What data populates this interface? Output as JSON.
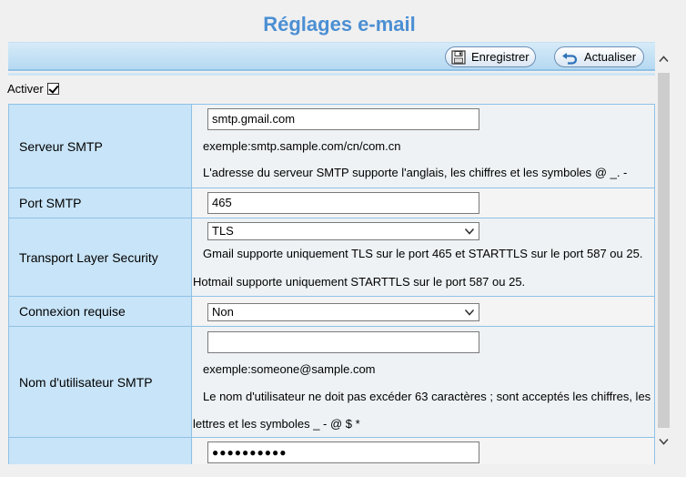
{
  "page_title": "Réglages e-mail",
  "toolbar": {
    "save_label": "Enregistrer",
    "save_icon": "save-icon",
    "refresh_label": "Actualiser",
    "refresh_icon": "refresh-icon"
  },
  "enable": {
    "label": "Activer",
    "checked": true
  },
  "fields": {
    "smtp_server": {
      "label": "Serveur SMTP",
      "value": "smtp.gmail.com",
      "example": "exemple:smtp.sample.com/cn/com.cn",
      "hint": "L'adresse du serveur SMTP supporte l'anglais, les chiffres et les symboles @ _. -"
    },
    "smtp_port": {
      "label": "Port SMTP",
      "value": "465"
    },
    "tls": {
      "label": "Transport Layer Security",
      "value": "TLS",
      "hint1": "Gmail supporte uniquement TLS sur le port 465 et STARTTLS sur le port 587 ou 25.",
      "hint2": "Hotmail supporte uniquement STARTTLS sur le port 587 ou 25."
    },
    "auth_required": {
      "label": "Connexion requise",
      "value": "Non"
    },
    "smtp_username": {
      "label": "Nom d'utilisateur SMTP",
      "value": "",
      "example": "exemple:someone@sample.com",
      "hint1": "Le nom d'utilisateur ne doit pas excéder 63 caractères ; sont acceptés les chiffres, les",
      "hint2": "lettres et les symboles _ - @ $ *"
    },
    "smtp_password": {
      "value": "●●●●●●●●●●"
    }
  },
  "colors": {
    "title": "#4b8fd3",
    "label_bg": "#c8e4f8",
    "border": "#8fc1e6"
  }
}
